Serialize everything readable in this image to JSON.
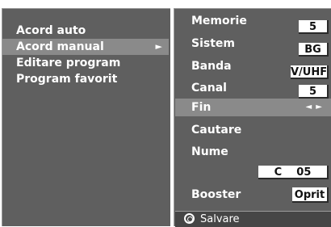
{
  "left_menu": {
    "items": [
      {
        "label": "Acord auto"
      },
      {
        "label": "Acord manual",
        "arrow": "►"
      },
      {
        "label": "Editare  program"
      },
      {
        "label": "Program favorit"
      }
    ]
  },
  "settings": {
    "memorie": {
      "label": "Memorie",
      "value": "5"
    },
    "sistem": {
      "label": "Sistem",
      "value": "BG"
    },
    "banda": {
      "label": "Banda",
      "value": "V/UHF"
    },
    "canal": {
      "label": "Canal",
      "value": "5"
    },
    "fin": {
      "label": "Fin",
      "arrows": "◄ ►"
    },
    "cautare": {
      "label": "Cautare"
    },
    "nume": {
      "label": "Nume",
      "value": "C    05"
    },
    "booster": {
      "label": "Booster",
      "value": "Oprit"
    }
  },
  "footer": {
    "save_icon": "ok-button-icon",
    "save_label": "Salvare"
  },
  "colors": {
    "panel_bg": "#5f5f5f",
    "highlight_bg": "#8a8a8a",
    "footer_bg": "#464646",
    "value_box_bg": "#ffffff"
  }
}
